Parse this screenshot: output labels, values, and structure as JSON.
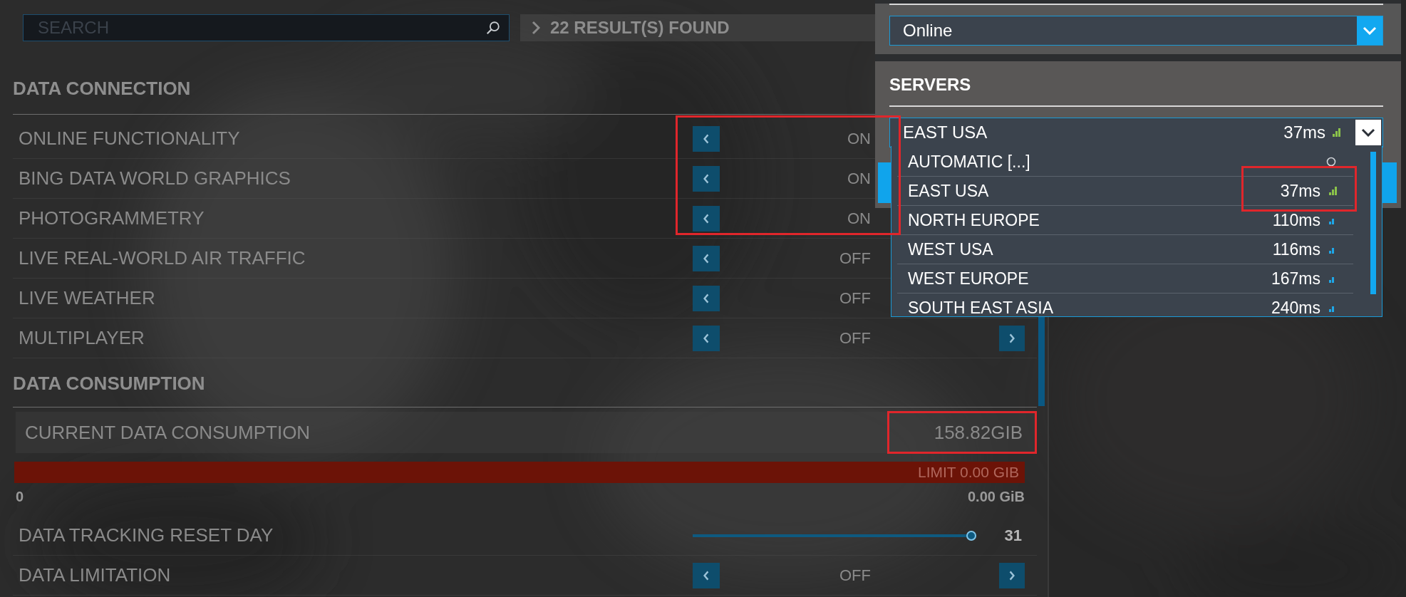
{
  "search": {
    "placeholder": "SEARCH"
  },
  "results": {
    "text": "22 RESULT(S) FOUND"
  },
  "sections": [
    {
      "title": "DATA CONNECTION",
      "rows": [
        {
          "kind": "toggle",
          "label": "ONLINE FUNCTIONALITY",
          "value": "ON",
          "highlighted": true,
          "next_visible": false
        },
        {
          "kind": "toggle",
          "label": "BING DATA WORLD GRAPHICS",
          "value": "ON",
          "highlighted": true,
          "next_visible": false
        },
        {
          "kind": "toggle",
          "label": "PHOTOGRAMMETRY",
          "value": "ON",
          "highlighted": true,
          "next_visible": false
        },
        {
          "kind": "toggle",
          "label": "LIVE REAL-WORLD AIR TRAFFIC",
          "value": "OFF"
        },
        {
          "kind": "toggle",
          "label": "LIVE WEATHER",
          "value": "OFF"
        },
        {
          "kind": "toggle",
          "label": "MULTIPLAYER",
          "value": "OFF",
          "highlighted": false,
          "next_visible": true
        }
      ]
    },
    {
      "title": "DATA CONSUMPTION",
      "rows": [
        {
          "kind": "readout",
          "label": "CURRENT DATA CONSUMPTION",
          "value": "158.82GIB",
          "highlighted": true
        },
        {
          "kind": "meter",
          "level": 1,
          "caption": "LIMIT 0.00 GIB",
          "min_label": "0",
          "max_label": "0.00 GiB"
        },
        {
          "kind": "slider",
          "label": "DATA TRACKING RESET DAY",
          "level": 1,
          "value": "31"
        },
        {
          "kind": "toggle",
          "label": "DATA LIMITATION",
          "value": "OFF",
          "highlighted": false,
          "next_visible": true
        }
      ]
    }
  ],
  "panel": {
    "mode_select": {
      "value": "Online"
    },
    "servers": {
      "title": "SERVERS",
      "value": "EAST USA",
      "latency": "37ms",
      "strong_signal": true,
      "options": [
        {
          "kind": "automatic",
          "name": "AUTOMATIC [...]",
          "highlighted": false
        },
        {
          "kind": "server",
          "name": "EAST USA",
          "latency": "37ms",
          "strong_signal": true,
          "highlighted": true
        },
        {
          "kind": "server",
          "name": "NORTH EUROPE",
          "latency": "110ms",
          "strong_signal": false,
          "highlighted": false
        },
        {
          "kind": "server",
          "name": "WEST USA",
          "latency": "116ms",
          "strong_signal": false,
          "highlighted": false
        },
        {
          "kind": "server",
          "name": "WEST EUROPE",
          "latency": "167ms",
          "strong_signal": false,
          "highlighted": false
        },
        {
          "kind": "server",
          "name": "SOUTH EAST ASIA",
          "latency": "240ms",
          "strong_signal": false,
          "highlighted": false
        }
      ]
    }
  }
}
